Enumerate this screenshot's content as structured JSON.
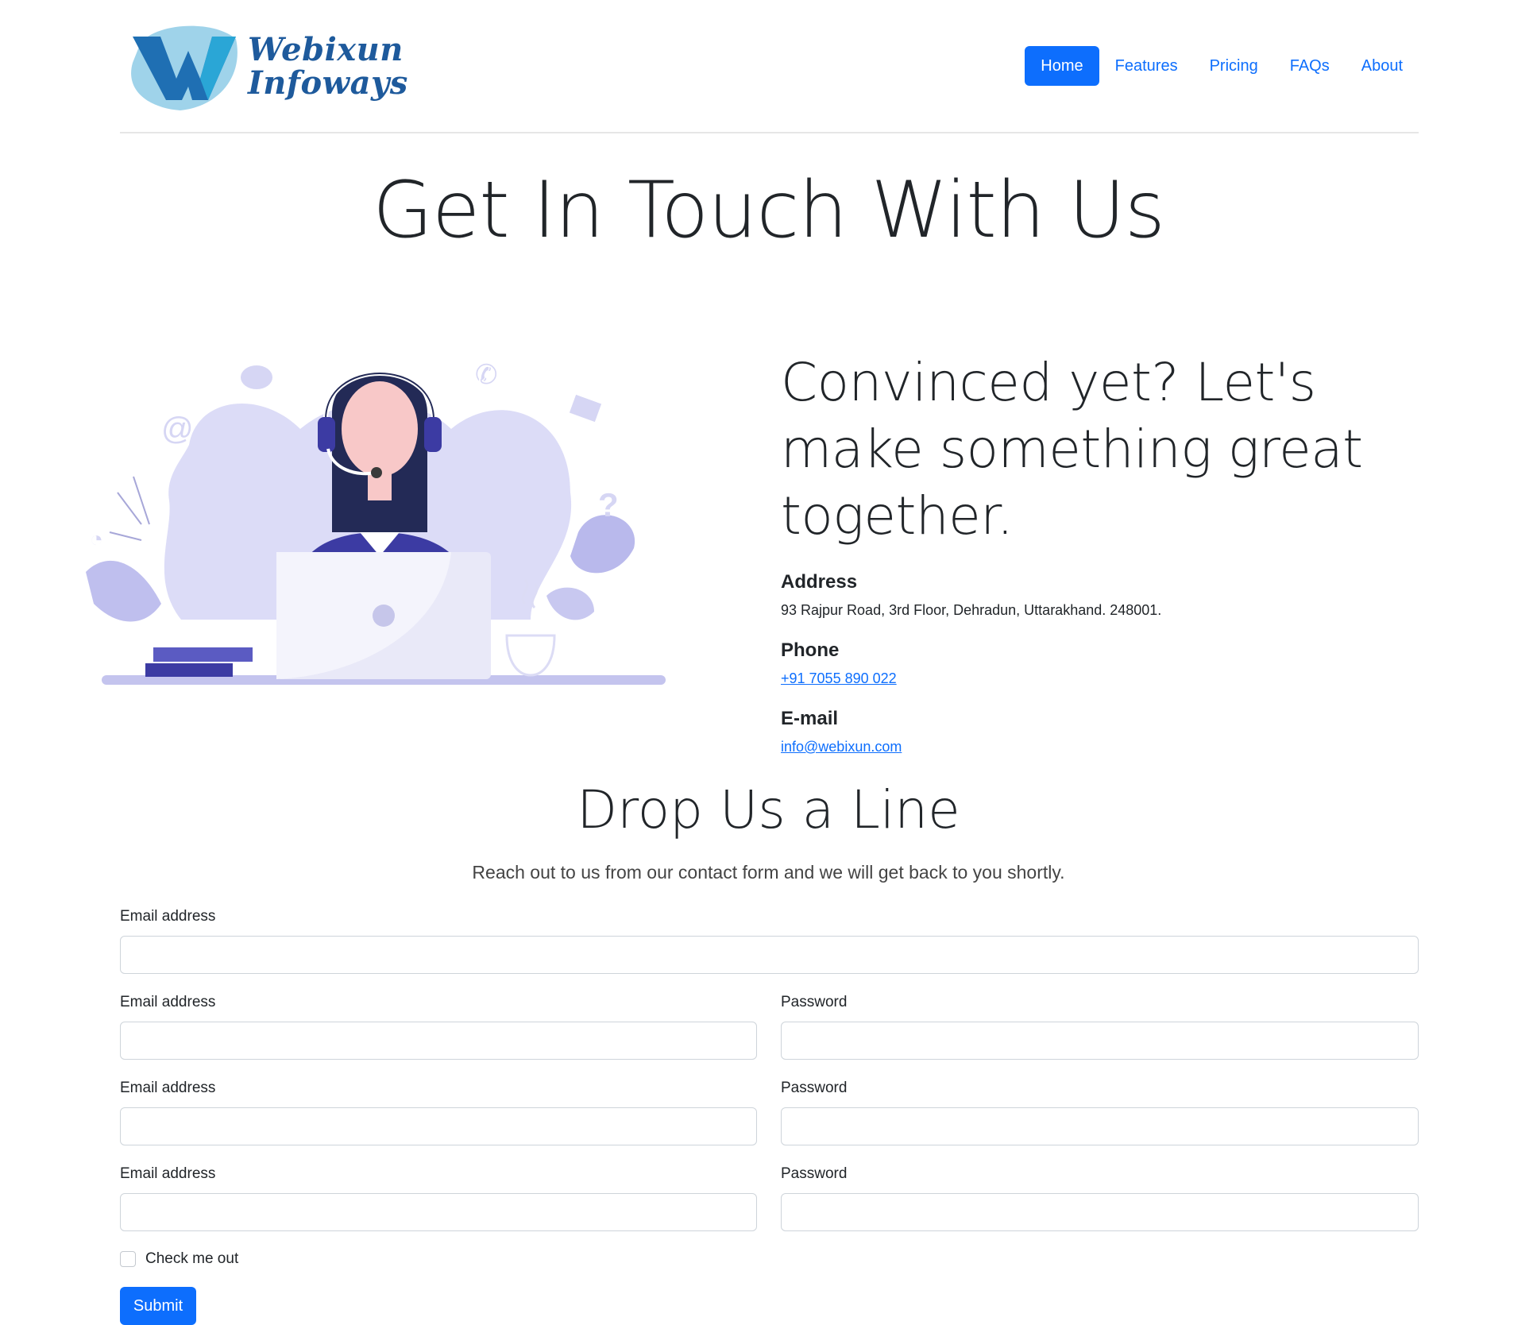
{
  "brand": {
    "line1": "Webixun",
    "line2": "Infoways"
  },
  "nav": [
    {
      "label": "Home",
      "active": true
    },
    {
      "label": "Features"
    },
    {
      "label": "Pricing"
    },
    {
      "label": "FAQs"
    },
    {
      "label": "About"
    }
  ],
  "hero": {
    "title": "Get In Touch With Us"
  },
  "contact": {
    "heading": "Convinced yet? Let's make something great together.",
    "address_label": "Address",
    "address": "93 Rajpur Road, 3rd Floor, Dehradun, Uttarakhand. 248001.",
    "phone_label": "Phone",
    "phone": "+91 7055 890 022",
    "email_label": "E-mail",
    "email": "info@webixun.com"
  },
  "form_section": {
    "title": "Drop Us a Line",
    "subtitle": "Reach out to us from our contact form and we will get back to you shortly.",
    "fields": {
      "f1": "Email address",
      "f2": "Email address",
      "f3": "Password",
      "f4": "Email address",
      "f5": "Password",
      "f6": "Email address",
      "f7": "Password"
    },
    "check_label": "Check me out",
    "submit_label": "Submit"
  },
  "colors": {
    "primary": "#0d6efd",
    "illustration": "#d9d9f5",
    "illustration_dark": "#3c3ba3"
  },
  "icons": [
    "chat-bubble-icon",
    "phone-icon",
    "envelope-icon",
    "at-sign-icon",
    "question-mark-icon",
    "wifi-icon",
    "coffee-cup-icon"
  ]
}
